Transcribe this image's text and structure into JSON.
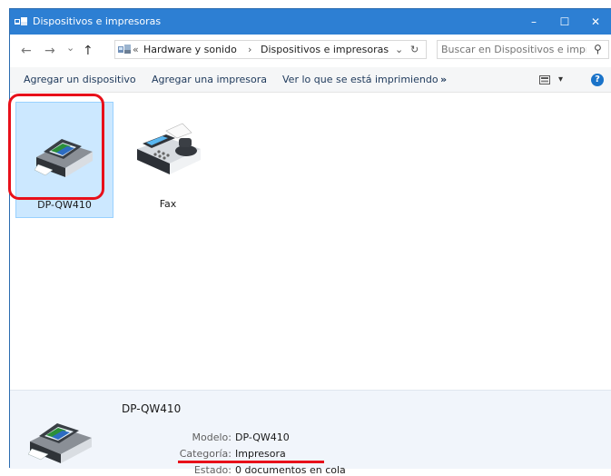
{
  "window": {
    "title": "Dispositivos e impresoras",
    "title_icon": "devices-printers-icon",
    "controls": {
      "minimize": "–",
      "maximize": "☐",
      "close": "✕"
    }
  },
  "address_bar": {
    "back_icon": "←",
    "forward_icon": "→",
    "recent_icon": "⌄",
    "up_icon": "↑",
    "chevrons": "«",
    "breadcrumbs": [
      "Hardware y sonido",
      "Dispositivos e impresoras"
    ],
    "separator": "›",
    "dropdown_icon": "⌄",
    "refresh_icon": "↻",
    "search_placeholder": "Buscar en Dispositivos e impr...",
    "search_icon": "⚲"
  },
  "toolbar": {
    "add_device": "Agregar un dispositivo",
    "add_printer": "Agregar una impresora",
    "see_printing": "Ver lo que se está imprimiendo",
    "more": "»",
    "view_icon": "view-options-icon",
    "view_dropdown": "▾",
    "help": "?"
  },
  "devices": [
    {
      "name": "DP-QW410",
      "icon": "printer-icon",
      "selected": true
    },
    {
      "name": "Fax",
      "icon": "fax-icon",
      "selected": false
    }
  ],
  "details": {
    "device_name": "DP-QW410",
    "fields": [
      {
        "label": "Modelo:",
        "value": "DP-QW410"
      },
      {
        "label": "Categoría:",
        "value": "Impresora"
      },
      {
        "label": "Estado:",
        "value": "0 documentos en cola"
      }
    ]
  },
  "colors": {
    "titlebar": "#2d7fd3",
    "toolbar_text": "#1e395b",
    "selection": "#cce8ff",
    "highlight": "#e8101a"
  }
}
